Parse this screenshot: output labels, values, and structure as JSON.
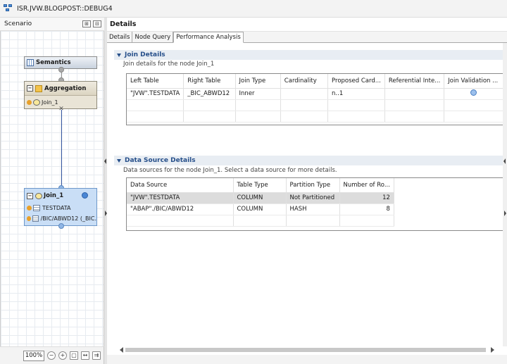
{
  "window": {
    "title": "ISR.JVW.BLOGPOST::DEBUG4"
  },
  "scenario": {
    "label": "Scenario",
    "tool_expand": "⊞",
    "tool_collapse": "⊟",
    "nodes": {
      "semantics": {
        "label": "Semantics"
      },
      "aggregation": {
        "label": "Aggregation",
        "input": "Join_1"
      },
      "join": {
        "label": "Join_1",
        "inputs": [
          "TESTDATA",
          "/BIC/ABWD12 (_BIC."
        ]
      }
    },
    "zoom": {
      "level": "100%"
    }
  },
  "details": {
    "title": "Details",
    "tabs": [
      {
        "label": "Details",
        "active": false
      },
      {
        "label": "Node Query",
        "active": false
      },
      {
        "label": "Performance Analysis",
        "active": true
      }
    ],
    "join_section": {
      "title": "Join Details",
      "description": "Join details for the node Join_1",
      "columns": [
        "Left Table",
        "Right Table",
        "Join Type",
        "Cardinality",
        "Proposed Card...",
        "Referential Inte...",
        "Join Validation ..."
      ],
      "rows": [
        {
          "left_table": "\"JVW\".TESTDATA",
          "right_table": "_BIC_ABWD12",
          "join_type": "Inner",
          "cardinality": "",
          "proposed_cardinality": "n..1",
          "referential_integrity": "",
          "join_validation": "info"
        }
      ]
    },
    "datasource_section": {
      "title": "Data Source Details",
      "description": "Data sources for the node Join_1. Select a data source for more details.",
      "columns": [
        "Data Source",
        "Table Type",
        "Partition Type",
        "Number of Ro..."
      ],
      "rows": [
        {
          "data_source": "\"JVW\".TESTDATA",
          "table_type": "COLUMN",
          "partition_type": "Not Partitioned",
          "rows": "12",
          "selected": true
        },
        {
          "data_source": "\"ABAP\"./BIC/ABWD12",
          "table_type": "COLUMN",
          "partition_type": "HASH",
          "rows": "8",
          "selected": false
        }
      ]
    }
  }
}
